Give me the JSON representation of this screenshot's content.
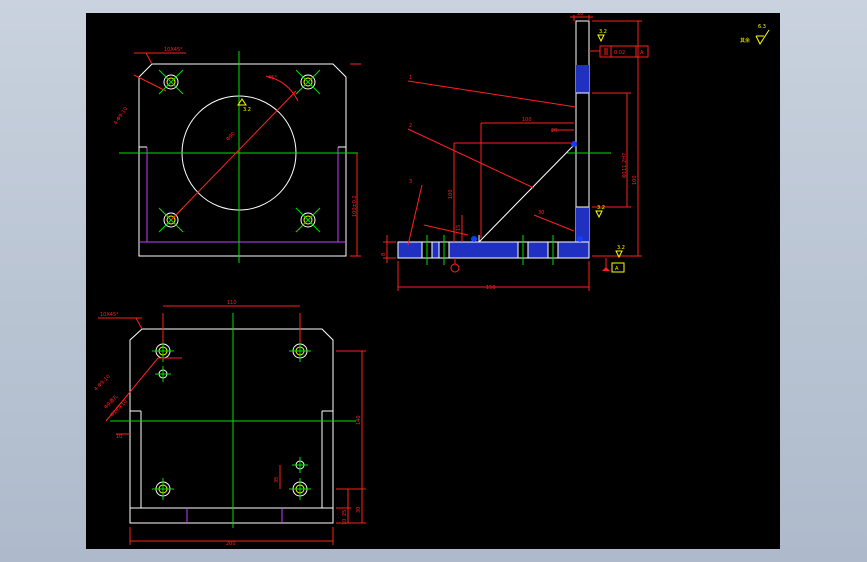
{
  "colors": {
    "background": "#000000",
    "outline": "#ffffff",
    "dimension": "#ff2020",
    "centerline": "#00e000",
    "hidden": "#c040ff",
    "leader": "#ffff00",
    "hatch": "#2030c0",
    "weld": "#1040ff",
    "annotation": "#00ffff"
  },
  "dims": {
    "top_chamfer": "10X45°",
    "top_holes": "4-Φ9-10",
    "top_bore": "Φ90",
    "top_angle": "45°",
    "top_height": "100±0.2",
    "side_thick": "10",
    "side_span": "100",
    "side_height": "100",
    "side_short": "20",
    "side_gap": "30",
    "side_mid": "15",
    "side_base": "150",
    "side_side": "8",
    "side_vert": "Φ111.2H7",
    "bottom_chamfer": "10X45°",
    "bottom_span": "110",
    "bottom_holes": "4-Φ9-10",
    "bottom_note1": "Φ9通孔",
    "bottom_note2": "Φ14深10",
    "bottom_left": "10",
    "bottom_height": "140",
    "bottom_a": "35",
    "bottom_b": "25",
    "bottom_c": "10",
    "bottom_d": "30",
    "bottom_width": "200"
  },
  "balloons": {
    "b1": "1",
    "b2": "2",
    "b3": "3"
  },
  "gdt": {
    "parallel": "0.02",
    "datum": "A"
  },
  "datum": {
    "label": "A"
  },
  "roughness": {
    "main": "3.2",
    "rest_label": "其余",
    "rest_value": "6.3",
    "side1": "3.2",
    "side2": "3.2",
    "side3": "3.2",
    "bottom": "3.2"
  }
}
